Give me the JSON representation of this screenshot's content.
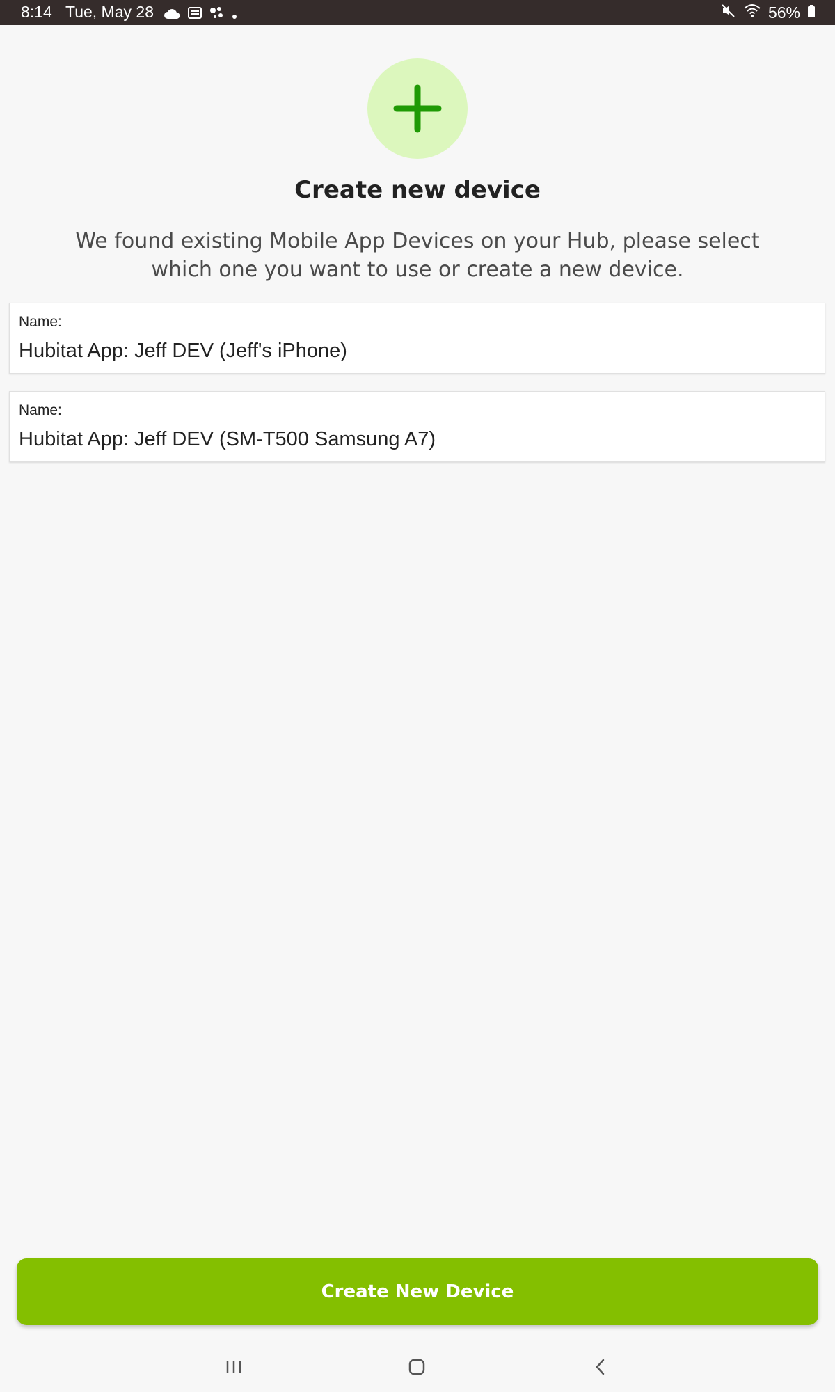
{
  "status_bar": {
    "time": "8:14",
    "date": "Tue, May 28",
    "battery": "56%",
    "notification_icons": [
      "cloud-icon",
      "inbox-icon",
      "assistant-icon",
      "dot-icon"
    ],
    "system_icons": [
      "mute-icon",
      "wifi-icon",
      "battery-icon"
    ]
  },
  "header": {
    "icon": "plus-icon",
    "title": "Create new device",
    "description": "We found existing Mobile App Devices on your Hub, please select which one you want to use or create a new device."
  },
  "devices": [
    {
      "label": "Name:",
      "name": "Hubitat App: Jeff DEV (Jeff's iPhone)"
    },
    {
      "label": "Name:",
      "name": "Hubitat App: Jeff DEV (SM-T500 Samsung A7)"
    }
  ],
  "primary_action": {
    "label": "Create New Device"
  },
  "navigation": [
    "recents-icon",
    "home-icon",
    "back-icon"
  ],
  "colors": {
    "accent": "#84bf00",
    "icon_bg": "#dcf7bd",
    "icon_fg": "#1f9a05",
    "status_bar_bg": "#352c2b",
    "background": "#f7f7f7"
  }
}
